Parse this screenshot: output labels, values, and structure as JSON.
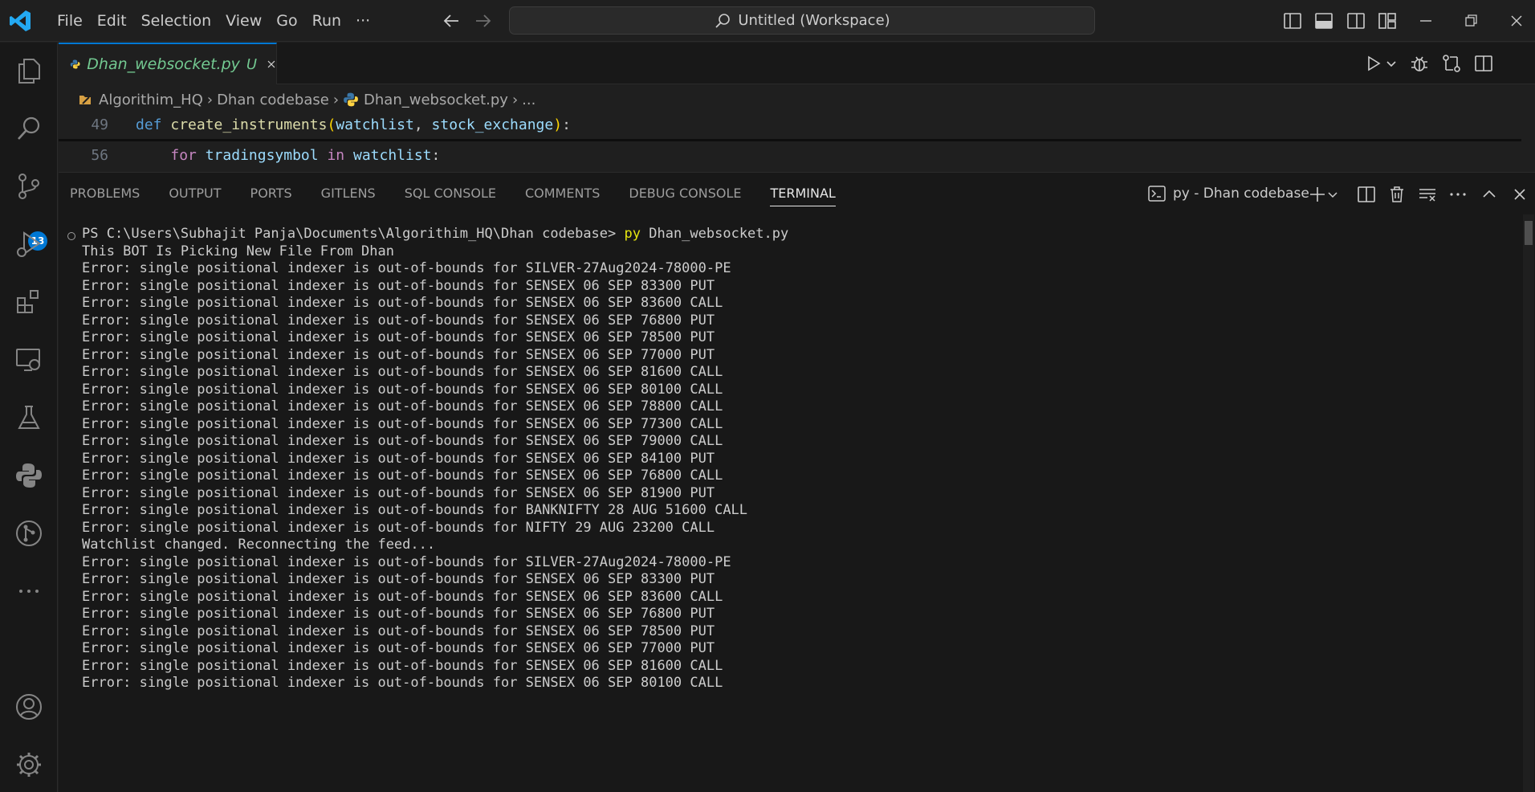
{
  "menu": [
    "File",
    "Edit",
    "Selection",
    "View",
    "Go",
    "Run",
    "···"
  ],
  "command_center": {
    "label": "Untitled (Workspace)"
  },
  "activity": {
    "scm_badge": "13"
  },
  "editor": {
    "tab": {
      "name": "Dhan_websocket.py",
      "status": "U"
    },
    "breadcrumbs": [
      "Algorithim_HQ",
      "Dhan codebase",
      "Dhan_websocket.py",
      "..."
    ],
    "lines": [
      {
        "num": "49",
        "kw": "def",
        "fn": "create_instruments",
        "open": "(",
        "p1": "watchlist",
        "comma": ", ",
        "p2": "stock_exchange",
        "close": ")",
        "end": ":"
      },
      {
        "num": "56",
        "kw": "for",
        "var": "tradingsymbol",
        "kw_in": "in",
        "iter": "watchlist",
        "end": ":"
      }
    ]
  },
  "panel": {
    "tabs": [
      "PROBLEMS",
      "OUTPUT",
      "PORTS",
      "GITLENS",
      "SQL CONSOLE",
      "COMMENTS",
      "DEBUG CONSOLE",
      "TERMINAL"
    ],
    "active_tab": "TERMINAL",
    "terminal_name": "py - Dhan codebase"
  },
  "terminal": {
    "prompt": "PS C:\\Users\\Subhajit Panja\\Documents\\Algorithim_HQ\\Dhan codebase> ",
    "cmd_py": "py",
    "cmd_arg": " Dhan_websocket.py",
    "lines": [
      "This BOT Is Picking New File From Dhan",
      "Error: single positional indexer is out-of-bounds for SILVER-27Aug2024-78000-PE",
      "Error: single positional indexer is out-of-bounds for SENSEX 06 SEP 83300 PUT",
      "Error: single positional indexer is out-of-bounds for SENSEX 06 SEP 83600 CALL",
      "Error: single positional indexer is out-of-bounds for SENSEX 06 SEP 76800 PUT",
      "Error: single positional indexer is out-of-bounds for SENSEX 06 SEP 78500 PUT",
      "Error: single positional indexer is out-of-bounds for SENSEX 06 SEP 77000 PUT",
      "Error: single positional indexer is out-of-bounds for SENSEX 06 SEP 81600 CALL",
      "Error: single positional indexer is out-of-bounds for SENSEX 06 SEP 80100 CALL",
      "Error: single positional indexer is out-of-bounds for SENSEX 06 SEP 78800 CALL",
      "Error: single positional indexer is out-of-bounds for SENSEX 06 SEP 77300 CALL",
      "Error: single positional indexer is out-of-bounds for SENSEX 06 SEP 79000 CALL",
      "Error: single positional indexer is out-of-bounds for SENSEX 06 SEP 84100 PUT",
      "Error: single positional indexer is out-of-bounds for SENSEX 06 SEP 76800 CALL",
      "Error: single positional indexer is out-of-bounds for SENSEX 06 SEP 81900 PUT",
      "Error: single positional indexer is out-of-bounds for BANKNIFTY 28 AUG 51600 CALL",
      "Error: single positional indexer is out-of-bounds for NIFTY 29 AUG 23200 CALL",
      "Watchlist changed. Reconnecting the feed...",
      "Error: single positional indexer is out-of-bounds for SILVER-27Aug2024-78000-PE",
      "Error: single positional indexer is out-of-bounds for SENSEX 06 SEP 83300 PUT",
      "Error: single positional indexer is out-of-bounds for SENSEX 06 SEP 83600 CALL",
      "Error: single positional indexer is out-of-bounds for SENSEX 06 SEP 76800 PUT",
      "Error: single positional indexer is out-of-bounds for SENSEX 06 SEP 78500 PUT",
      "Error: single positional indexer is out-of-bounds for SENSEX 06 SEP 77000 PUT",
      "Error: single positional indexer is out-of-bounds for SENSEX 06 SEP 81600 CALL",
      "Error: single positional indexer is out-of-bounds for SENSEX 06 SEP 80100 CALL"
    ]
  },
  "colors": {
    "accent": "#0078d4",
    "untracked": "#73c991",
    "logo": "#23a9f2",
    "python_blue": "#3b77a8",
    "python_yellow": "#ffd343"
  },
  "icons": {
    "titlebar": [
      "vscode-logo-icon",
      "arrow-left-icon",
      "arrow-right-icon",
      "search-icon",
      "toggle-sidebar-icon",
      "toggle-panel-icon",
      "toggle-secondary-sidebar-icon",
      "customize-layout-icon",
      "minimize-icon",
      "restore-icon",
      "close-icon"
    ],
    "activity": [
      "explorer-icon",
      "search-icon",
      "source-control-icon",
      "run-debug-icon",
      "extensions-icon",
      "remote-explorer-icon",
      "testing-icon",
      "python-icon",
      "git-graph-icon",
      "more-icon",
      "accounts-icon",
      "manage-gear-icon"
    ],
    "editor_actions": [
      "run-icon",
      "chevron-down-icon",
      "debug-icon",
      "compare-changes-icon",
      "split-editor-icon"
    ],
    "panel_actions": [
      "terminal-icon",
      "plus-icon",
      "chevron-down-icon",
      "split-terminal-icon",
      "trash-icon",
      "clear-icon",
      "more-icon",
      "maximize-chevron-up-icon",
      "close-panel-icon"
    ]
  }
}
